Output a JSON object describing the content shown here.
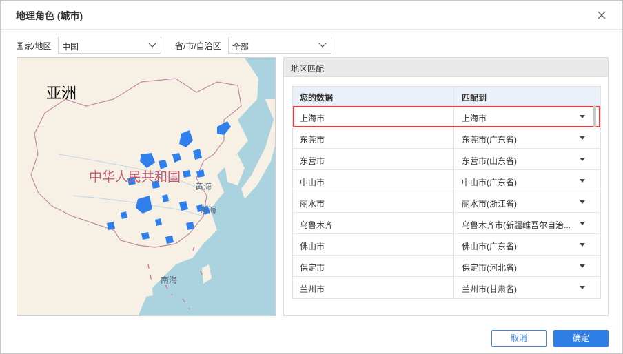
{
  "dialog": {
    "title": "地理角色 (城市)"
  },
  "filters": {
    "country_label": "国家/地区",
    "country_value": "中国",
    "province_label": "省/市/自治区",
    "province_value": "全部"
  },
  "map": {
    "labels": {
      "continent": "亚洲",
      "country": "中华人民共和国",
      "yellow_sea": "黄海",
      "east_sea": "东海",
      "south_sea": "南海"
    },
    "colors": {
      "land": "#f7f1e5",
      "water": "#aad3df",
      "border": "#c18aa3",
      "highlight": "#2f80ed"
    }
  },
  "panel": {
    "title": "地区匹配",
    "headers": {
      "your_data": "您的数据",
      "match_to": "匹配到"
    },
    "rows": [
      {
        "data": "上海市",
        "match": "上海市"
      },
      {
        "data": "东莞市",
        "match": "东莞市(广东省)"
      },
      {
        "data": "东营市",
        "match": "东营市(山东省)"
      },
      {
        "data": "中山市",
        "match": "中山市(广东省)"
      },
      {
        "data": "丽水市",
        "match": "丽水市(浙江省)"
      },
      {
        "data": "乌鲁木齐",
        "match": "乌鲁木齐市(新疆维吾尔自治..."
      },
      {
        "data": "佛山市",
        "match": "佛山市(广东省)"
      },
      {
        "data": "保定市",
        "match": "保定市(河北省)"
      },
      {
        "data": "兰州市",
        "match": "兰州市(甘肃省)"
      }
    ]
  },
  "buttons": {
    "cancel": "取消",
    "ok": "确定"
  },
  "accent_color": "#2f7ee6",
  "highlight_border_color": "#e53e3e"
}
